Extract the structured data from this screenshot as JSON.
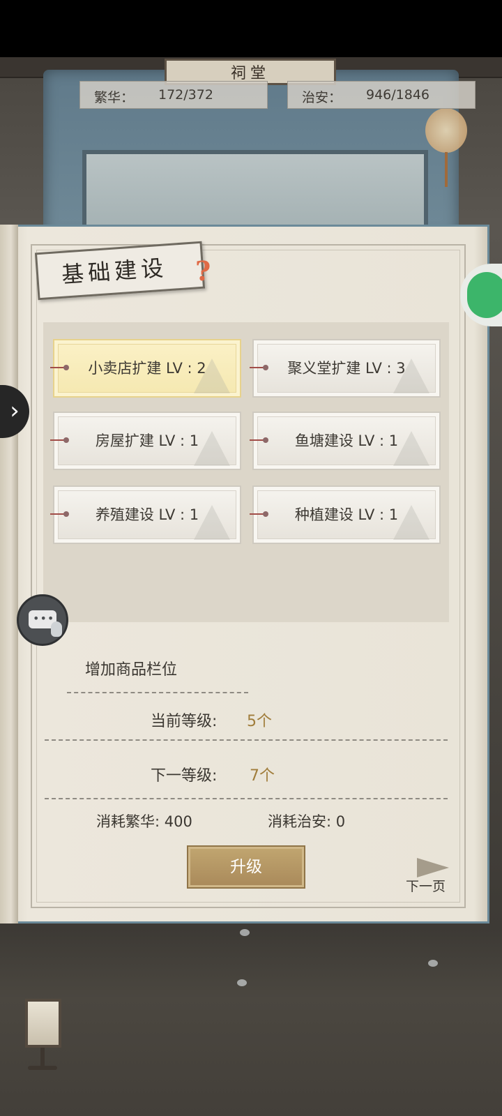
{
  "header": {
    "plaque_text": "祠堂",
    "prosperity": {
      "label": "繁华：",
      "value": "172/372"
    },
    "security": {
      "label": "治安：",
      "value": "946/1846"
    }
  },
  "panel": {
    "title": "基础建设",
    "help_glyph": "?",
    "buildings": [
      {
        "label": "小卖店扩建 LV : 2",
        "selected": true
      },
      {
        "label": "聚义堂扩建 LV : 3",
        "selected": false
      },
      {
        "label": "房屋扩建 LV : 1",
        "selected": false
      },
      {
        "label": "鱼塘建设 LV : 1",
        "selected": false
      },
      {
        "label": "养殖建设 LV : 1",
        "selected": false
      },
      {
        "label": "种植建设 LV : 1",
        "selected": false
      }
    ],
    "detail": {
      "title": "增加商品栏位",
      "current_label": "当前等级:",
      "current_value": "5个",
      "next_label": "下一等级:",
      "next_value": "7个",
      "cost_prosperity_label": "消耗繁华:",
      "cost_prosperity_value": "400",
      "cost_security_label": "消耗治安:",
      "cost_security_value": "0"
    },
    "upgrade_label": "升级",
    "next_page_label": "下一页"
  },
  "colors": {
    "accent_gold": "#a9895a",
    "value_gold": "#a07d3b",
    "selected_bg": "#f5e8b0",
    "help_orange": "#e06a46",
    "wechat_green": "#3cb56a"
  },
  "icons": {
    "side_toggle": "chevron-right-icon",
    "chat": "chat-bubble-icon",
    "share": "wechat-icon",
    "next_page": "arrow-right-icon"
  }
}
